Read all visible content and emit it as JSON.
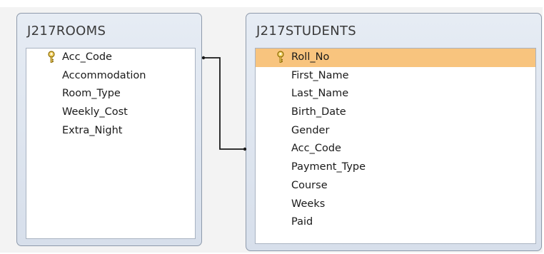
{
  "tables": {
    "rooms": {
      "title": "J217ROOMS",
      "fields": [
        "Acc_Code",
        "Accommodation",
        "Room_Type",
        "Weekly_Cost",
        "Extra_Night"
      ]
    },
    "students": {
      "title": "J217STUDENTS",
      "fields": [
        "Roll_No",
        "First_Name",
        "Last_Name",
        "Birth_Date",
        "Gender",
        "Acc_Code",
        "Payment_Type",
        "Course",
        "Weeks",
        "Paid"
      ]
    }
  },
  "relationship": {
    "from": "J217ROOMS.Acc_Code",
    "to": "J217STUDENTS.Acc_Code"
  },
  "colors": {
    "selected_row": "#f8c47e",
    "window_header": "#dfe6f0",
    "key_icon": "#d8a800"
  },
  "icons": {
    "primary_key": "key-icon"
  }
}
